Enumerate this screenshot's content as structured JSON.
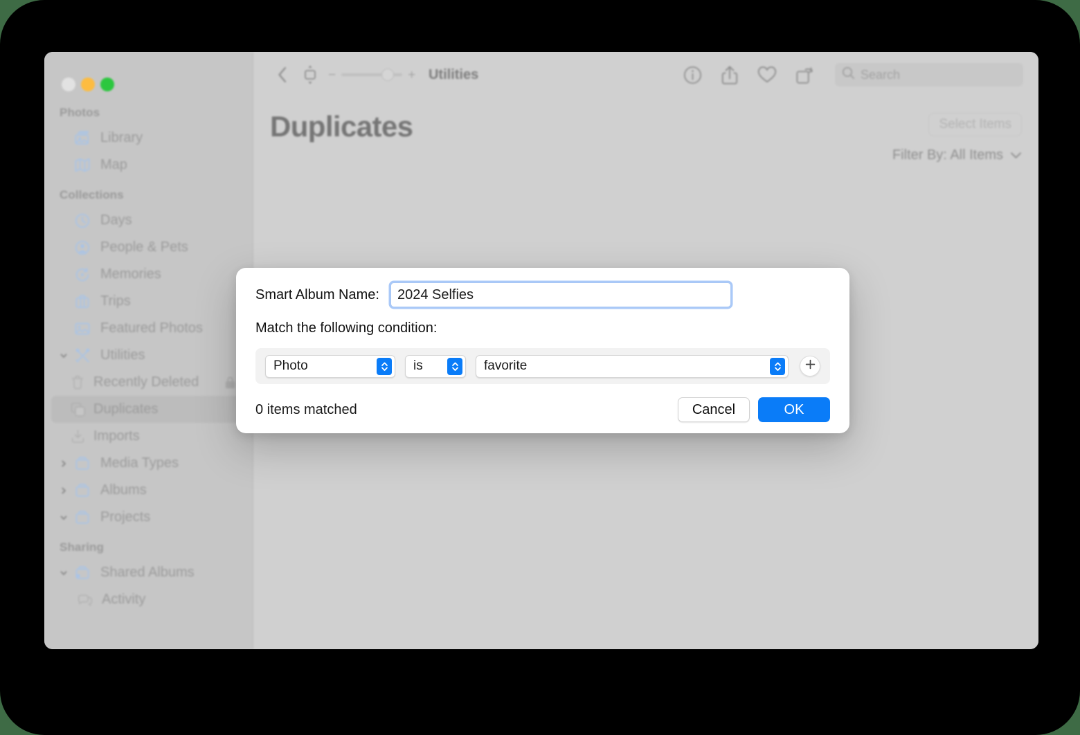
{
  "window": {
    "traffic_lights": [
      "close",
      "minimize",
      "zoom"
    ]
  },
  "toolbar": {
    "back_icon": "chevron-left-icon",
    "layout_icon": "aspect-ratio-icon",
    "zoom_out_label": "−",
    "zoom_in_label": "+",
    "title": "Utilities",
    "info_icon": "info-circle-icon",
    "share_icon": "share-icon",
    "favorite_icon": "heart-icon",
    "rotate_icon": "rotate-icon",
    "search": {
      "icon": "search-icon",
      "placeholder": "Search",
      "value": ""
    }
  },
  "page": {
    "title": "Duplicates",
    "select_items_label": "Select Items",
    "filter_label": "Filter By: All Items",
    "filter_chevron": "chevron-down-icon"
  },
  "sidebar": {
    "sections": [
      {
        "title": "Photos",
        "items": [
          {
            "label": "Library",
            "icon": "photos-library-icon",
            "indent": 0,
            "twisty": "",
            "selected": false
          },
          {
            "label": "Map",
            "icon": "map-icon",
            "indent": 0,
            "twisty": "",
            "selected": false
          }
        ]
      },
      {
        "title": "Collections",
        "items": [
          {
            "label": "Days",
            "icon": "clock-icon",
            "indent": 0,
            "twisty": "",
            "selected": false
          },
          {
            "label": "People & Pets",
            "icon": "person-circle-icon",
            "indent": 0,
            "twisty": "",
            "selected": false
          },
          {
            "label": "Memories",
            "icon": "memories-play-icon",
            "indent": 0,
            "twisty": "",
            "selected": false
          },
          {
            "label": "Trips",
            "icon": "suitcase-icon",
            "indent": 0,
            "twisty": "",
            "selected": false
          },
          {
            "label": "Featured Photos",
            "icon": "photo-icon",
            "indent": 0,
            "twisty": "",
            "selected": false
          },
          {
            "label": "Utilities",
            "icon": "tools-icon",
            "indent": 0,
            "twisty": "chevron-down-icon",
            "selected": false
          },
          {
            "label": "Recently Deleted",
            "icon": "trash-icon",
            "indent": 2,
            "twisty": "",
            "selected": false,
            "trailing_icon": "lock-icon"
          },
          {
            "label": "Duplicates",
            "icon": "duplicate-icon",
            "indent": 2,
            "twisty": "",
            "selected": true
          },
          {
            "label": "Imports",
            "icon": "import-icon",
            "indent": 2,
            "twisty": "",
            "selected": false
          },
          {
            "label": "Media Types",
            "icon": "folder-icon",
            "indent": 0,
            "twisty": "chevron-right-icon",
            "selected": false
          },
          {
            "label": "Albums",
            "icon": "folder-icon",
            "indent": 0,
            "twisty": "chevron-right-icon",
            "selected": false
          },
          {
            "label": "Projects",
            "icon": "folder-icon",
            "indent": 0,
            "twisty": "chevron-down-icon",
            "selected": false
          }
        ]
      },
      {
        "title": "Sharing",
        "items": [
          {
            "label": "Shared Albums",
            "icon": "shared-folder-icon",
            "indent": 0,
            "twisty": "chevron-down-icon",
            "selected": false
          },
          {
            "label": "Activity",
            "icon": "activity-bubbles-icon",
            "indent": 2,
            "twisty": "",
            "selected": false
          }
        ]
      }
    ]
  },
  "dialog": {
    "name_label": "Smart Album Name:",
    "name_value": "2024 Selfies",
    "match_label": "Match the following condition:",
    "condition": {
      "subject": "Photo",
      "operator": "is",
      "value": "favorite",
      "add_icon": "plus-icon"
    },
    "matched_text": "0 items matched",
    "cancel_label": "Cancel",
    "ok_label": "OK"
  },
  "colors": {
    "accent": "#0a7cf8",
    "window_bg": "#d0d0d0",
    "sidebar_bg": "#c6c6c6",
    "dialog_bg": "#ffffff",
    "backdrop": "#000000"
  }
}
